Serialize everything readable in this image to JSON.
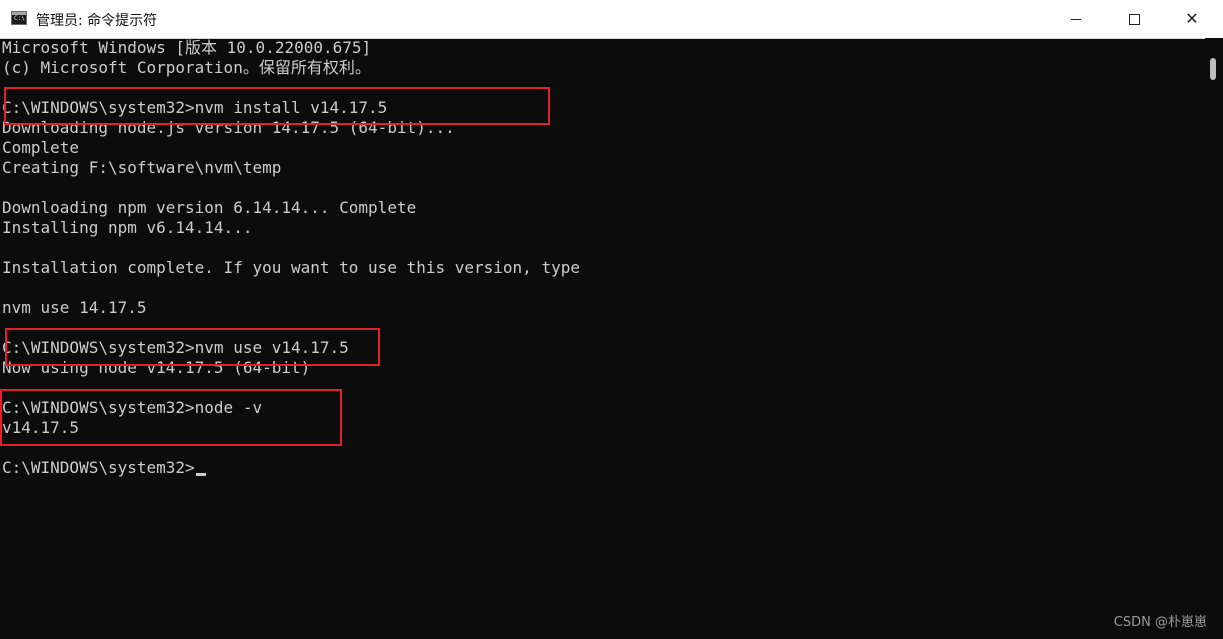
{
  "window": {
    "title": "管理员: 命令提示符",
    "app_icon_text": "C:\\",
    "controls": {
      "minimize": "minimize",
      "maximize": "maximize",
      "close": "✕"
    }
  },
  "console": {
    "lines": [
      "Microsoft Windows [版本 10.0.22000.675]",
      "(c) Microsoft Corporation。保留所有权利。",
      "",
      "C:\\WINDOWS\\system32>nvm install v14.17.5",
      "Downloading node.js version 14.17.5 (64-bit)...",
      "Complete",
      "Creating F:\\software\\nvm\\temp",
      "",
      "Downloading npm version 6.14.14... Complete",
      "Installing npm v6.14.14...",
      "",
      "Installation complete. If you want to use this version, type",
      "",
      "nvm use 14.17.5",
      "",
      "C:\\WINDOWS\\system32>nvm use v14.17.5",
      "Now using node v14.17.5 (64-bit)",
      "",
      "C:\\WINDOWS\\system32>node -v",
      "v14.17.5",
      "",
      "C:\\WINDOWS\\system32>"
    ]
  },
  "accent_color": "#e0222b",
  "watermark": "CSDN @朴崽崽"
}
